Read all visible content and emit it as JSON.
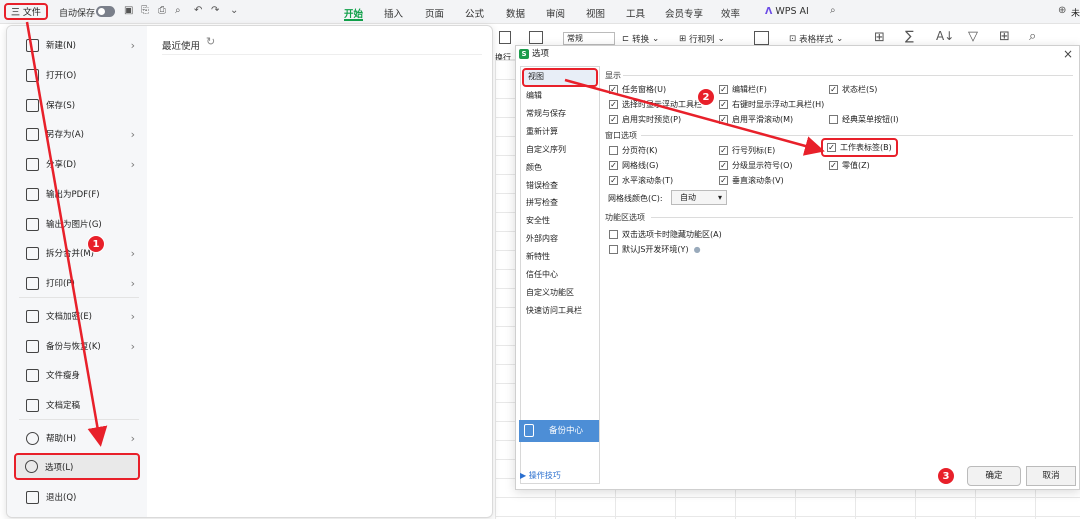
{
  "topbar": {
    "file_label": "三 文件",
    "autosave_label": "自动保存",
    "tabs": [
      "开始",
      "插入",
      "页面",
      "公式",
      "数据",
      "审阅",
      "视图",
      "工具",
      "会员专享",
      "效率"
    ],
    "wps_ai": "WPS AI",
    "right_partial": "未"
  },
  "ribbon": {
    "format_select": "常规",
    "convert": "转换",
    "rows_cols": "行和列",
    "table_style": "表格样式",
    "wrap": "换行"
  },
  "file_menu": {
    "items": [
      {
        "label": "新建(N)",
        "chevron": true
      },
      {
        "label": "打开(O)",
        "chevron": false
      },
      {
        "label": "保存(S)",
        "chevron": false
      },
      {
        "label": "另存为(A)",
        "chevron": true
      },
      {
        "label": "分享(D)",
        "chevron": true
      },
      {
        "label": "输出为PDF(F)",
        "chevron": false
      },
      {
        "label": "输出为图片(G)",
        "chevron": false
      },
      {
        "label": "拆分合并(M)",
        "chevron": true
      },
      {
        "label": "打印(P)",
        "chevron": true
      },
      {
        "label": "文档加密(E)",
        "chevron": true
      },
      {
        "label": "备份与恢复(K)",
        "chevron": true
      },
      {
        "label": "文件瘦身",
        "chevron": false
      },
      {
        "label": "文档定稿",
        "chevron": false
      },
      {
        "label": "帮助(H)",
        "chevron": true
      },
      {
        "label": "选项(L)",
        "chevron": false
      },
      {
        "label": "退出(Q)",
        "chevron": false
      }
    ],
    "recent_title": "最近使用"
  },
  "dialog": {
    "title": "选项",
    "nav": [
      "视图",
      "编辑",
      "常规与保存",
      "重新计算",
      "自定义序列",
      "颜色",
      "错误检查",
      "拼写检查",
      "安全性",
      "外部内容",
      "新特性",
      "信任中心",
      "自定义功能区",
      "快速访问工具栏"
    ],
    "section_display": "显示",
    "display_options": [
      {
        "label": "任务窗格(U)",
        "checked": true
      },
      {
        "label": "编辑栏(F)",
        "checked": true
      },
      {
        "label": "状态栏(S)",
        "checked": true
      },
      {
        "label": "选择时显示浮动工具栏",
        "checked": true
      },
      {
        "label": "右键时显示浮动工具栏(H)",
        "checked": true
      },
      {
        "label": "启用实时预览(P)",
        "checked": true
      },
      {
        "label": "启用平滑滚动(M)",
        "checked": true
      },
      {
        "label": "经典菜单按钮(I)",
        "checked": false
      }
    ],
    "section_window": "窗口选项",
    "window_options": [
      {
        "label": "分页符(K)",
        "checked": false
      },
      {
        "label": "行号列标(E)",
        "checked": true
      },
      {
        "label": "工作表标签(B)",
        "checked": true
      },
      {
        "label": "网格线(G)",
        "checked": true
      },
      {
        "label": "分级显示符号(O)",
        "checked": true
      },
      {
        "label": "零值(Z)",
        "checked": true
      },
      {
        "label": "水平滚动条(T)",
        "checked": true
      },
      {
        "label": "垂直滚动条(V)",
        "checked": true
      }
    ],
    "gridline_color_label": "网格线颜色(C):",
    "gridline_color_value": "自动",
    "section_ribbon": "功能区选项",
    "ribbon_options": [
      {
        "label": "双击选项卡时隐藏功能区(A)",
        "checked": false
      },
      {
        "label": "默认JS开发环境(Y)",
        "checked": false
      }
    ],
    "backup_center": "备份中心",
    "tips": "操作技巧",
    "ok": "确定",
    "cancel": "取消"
  },
  "annotations": {
    "step1": "1",
    "step2": "2",
    "step3": "3"
  },
  "colors": {
    "highlight": "#e8202a",
    "accent": "#11a04a",
    "backup_btn": "#4d8ed6"
  }
}
